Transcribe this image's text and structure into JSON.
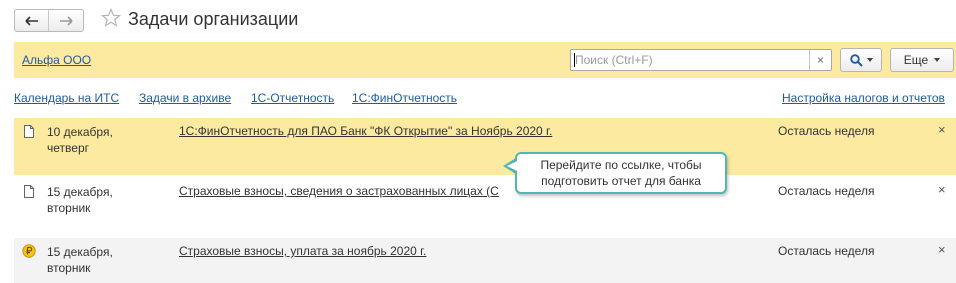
{
  "header": {
    "title": "Задачи организации",
    "back_icon": "arrow-left-icon",
    "forward_icon": "arrow-right-icon",
    "favorite_icon": "star-icon"
  },
  "toolbar": {
    "organization": "Альфа ООО",
    "search_placeholder": "Поиск (Ctrl+F)",
    "search_value": "",
    "clear_label": "×",
    "more_label": "Еще"
  },
  "links": {
    "calendar": "Календарь на ИТС",
    "archive": "Задачи в архиве",
    "reporting": "1С-Отчетность",
    "fin_reporting": "1С:ФинОтчетность",
    "tax_settings": "Настройка налогов и отчетов"
  },
  "tasks": [
    {
      "date_line1": "10 декабря,",
      "date_line2": "четверг",
      "title": "1С:ФинОтчетность для ПАО Банк \"ФК Открытие\" за Ноябрь 2020 г.",
      "status": "Осталась неделя",
      "icon": "document-icon",
      "close": "×"
    },
    {
      "date_line1": "15 декабря,",
      "date_line2": "вторник",
      "title": "Страховые взносы, сведения о застрахованных лицах (С",
      "status": "Осталась неделя",
      "icon": "document-icon",
      "close": "×"
    },
    {
      "date_line1": "15 декабря,",
      "date_line2": "вторник",
      "title": "Страховые взносы, уплата за ноябрь 2020 г.",
      "status": "Осталась неделя",
      "icon": "ruble-coin-icon",
      "close": "×"
    }
  ],
  "tooltip": {
    "line1": "Перейдите по ссылке, чтобы",
    "line2": "подготовить отчет для банка"
  },
  "colors": {
    "highlight": "#fbeaa0",
    "link": "#1f5aa3",
    "tooltip_border": "#52b7ae"
  }
}
